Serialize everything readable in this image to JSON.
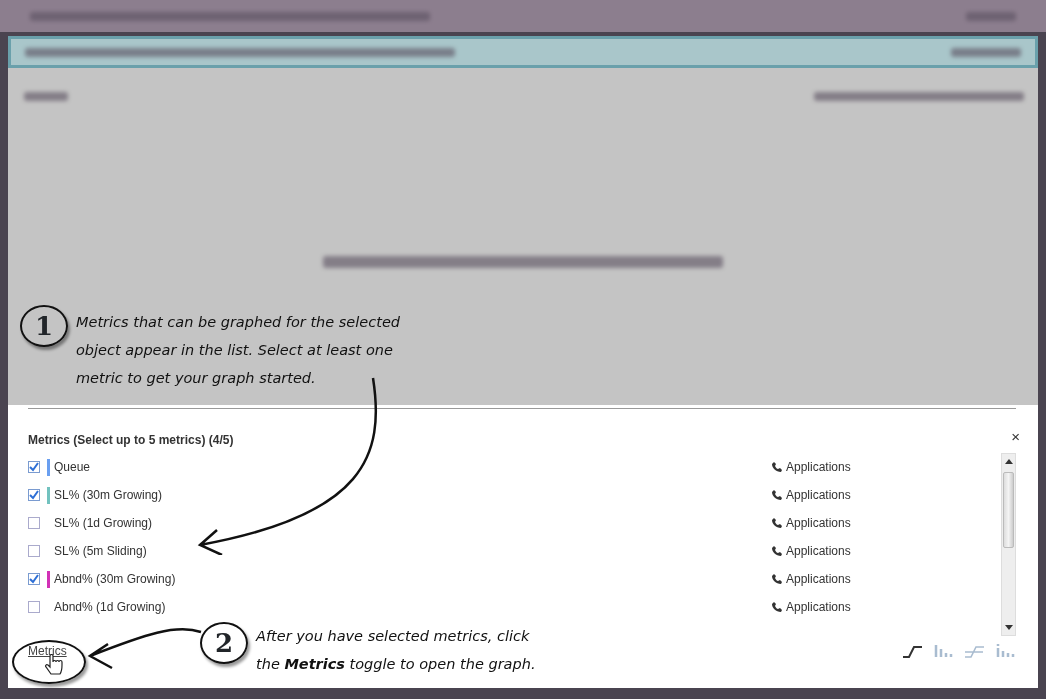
{
  "annotations": [
    {
      "number": "1",
      "text": "Metrics that can be graphed for the selected object appear in the list. Select at least one metric to get your graph started."
    },
    {
      "number": "2",
      "text": "After you have selected metrics, click the **Metrics** toggle to open the graph."
    }
  ],
  "panel": {
    "title": "Metrics (Select up to 5 metrics) (4/5)",
    "close": "×",
    "metrics": [
      {
        "name": "Queue",
        "checked": true,
        "color": "#6a9ff0",
        "category": "Applications"
      },
      {
        "name": "SL% (30m Growing)",
        "checked": true,
        "color": "#72c2bf",
        "category": "Applications"
      },
      {
        "name": "SL% (1d Growing)",
        "checked": false,
        "category": "Applications"
      },
      {
        "name": "SL% (5m Sliding)",
        "checked": false,
        "category": "Applications"
      },
      {
        "name": "Abnd% (30m Growing)",
        "checked": true,
        "color": "#d231b6",
        "category": "Applications"
      },
      {
        "name": "Abnd% (1d Growing)",
        "checked": false,
        "category": "Applications"
      }
    ],
    "toggle": "Metrics",
    "chart_types": [
      {
        "kind": "line",
        "selected": true
      },
      {
        "kind": "bar",
        "selected": false
      },
      {
        "kind": "step",
        "selected": false
      },
      {
        "kind": "dots",
        "selected": false
      }
    ]
  }
}
